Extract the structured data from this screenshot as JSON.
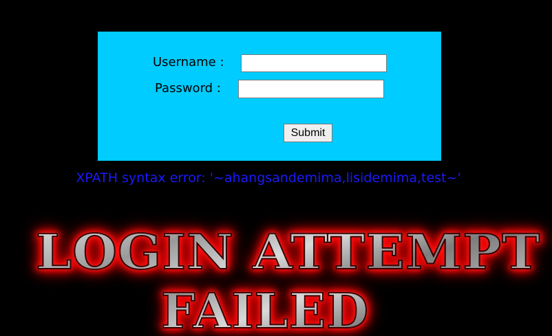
{
  "login_form": {
    "username_label": "Username :",
    "password_label": "Password :",
    "username_value": "",
    "password_value": "",
    "submit_label": "Submit"
  },
  "error": {
    "message": "XPATH syntax error: '~ahangsandemima,lisidemima,test~'"
  },
  "banner": {
    "line1": "LOGIN ATTEMPT",
    "line2": "FAILED"
  },
  "colors": {
    "page_background": "#000000",
    "panel_background": "#00CCFF",
    "error_text": "#1A1AFF",
    "banner_glow": "#FF0000"
  }
}
